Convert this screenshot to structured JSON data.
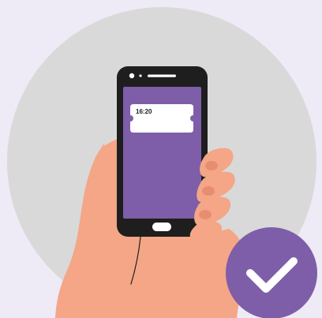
{
  "ticket": {
    "time": "16:20"
  },
  "colors": {
    "background": "#EEEAF6",
    "circle": "#D9D9D9",
    "phone_body": "#1E1E1E",
    "screen": "#7E5EA8",
    "ticket": "#FFFFFF",
    "skin": "#F4A687",
    "skin_shade": "#E88E70",
    "check_badge": "#7E5EA8",
    "check_mark": "#FFFFFF"
  },
  "icons": {
    "phone": "smartphone-icon",
    "ticket": "ticket-icon",
    "badge": "checkmark-icon"
  }
}
